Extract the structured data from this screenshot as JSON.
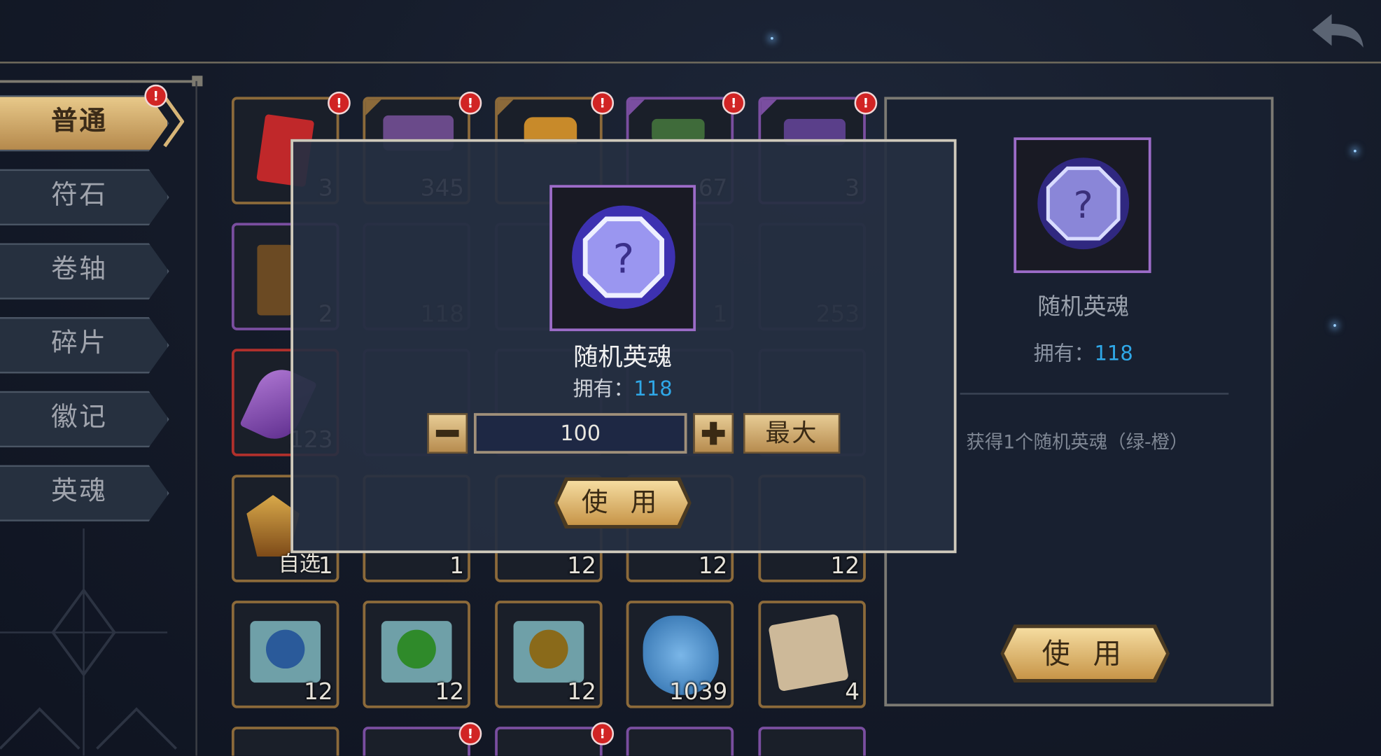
{
  "tabs": [
    {
      "label": "普通",
      "active": true,
      "badge": "!"
    },
    {
      "label": "符石",
      "active": false
    },
    {
      "label": "卷轴",
      "active": false
    },
    {
      "label": "碎片",
      "active": false
    },
    {
      "label": "徽记",
      "active": false
    },
    {
      "label": "英魂",
      "active": false
    }
  ],
  "grid": {
    "badge": "!",
    "row1_counts": [
      "3",
      "345",
      "",
      "67",
      "3"
    ],
    "row2_counts": [
      "2",
      "118",
      "",
      "1",
      "253"
    ],
    "row3_counts": [
      "123"
    ],
    "row4": {
      "label": "自选",
      "counts": [
        "1",
        "1",
        "12",
        "12",
        "12"
      ]
    },
    "row5_counts": [
      "12",
      "12",
      "12",
      "1039",
      "4"
    ]
  },
  "detail_panel": {
    "item_name": "随机英魂",
    "owned_label": "拥有：",
    "owned_value": "118",
    "description": "获得1个随机英魂（绿-橙）",
    "use_label": "使 用"
  },
  "modal": {
    "item_name": "随机英魂",
    "owned_label": "拥有：",
    "owned_value": "118",
    "quantity": "100",
    "max_label": "最大",
    "use_label": "使 用"
  },
  "colors": {
    "accent_gold": "#e0c088",
    "owned_blue": "#2fa8e8",
    "badge_red": "#d12424",
    "rare_purple": "#9c6cc8"
  }
}
